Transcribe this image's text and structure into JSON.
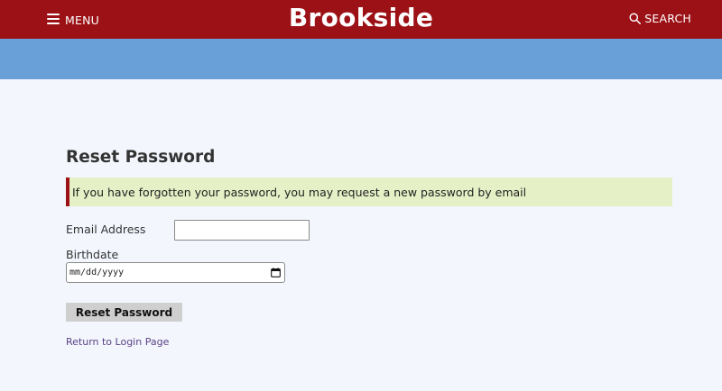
{
  "header": {
    "menu_label": "MENU",
    "brand": "Brookside",
    "search_label": "SEARCH"
  },
  "form": {
    "title": "Reset Password",
    "notice": "If you have forgotten your password, you may request a new password by email",
    "email_label": "Email Address",
    "email_value": "",
    "birthdate_label": "Birthdate",
    "birthdate_placeholder": "mm/dd/yyyy",
    "submit_label": "Reset Password",
    "return_link": "Return to Login Page"
  },
  "colors": {
    "header_bg": "#9b1116",
    "band_bg": "#6aa0d8",
    "notice_bg": "#e6f0c6",
    "link": "#5a3f84"
  }
}
